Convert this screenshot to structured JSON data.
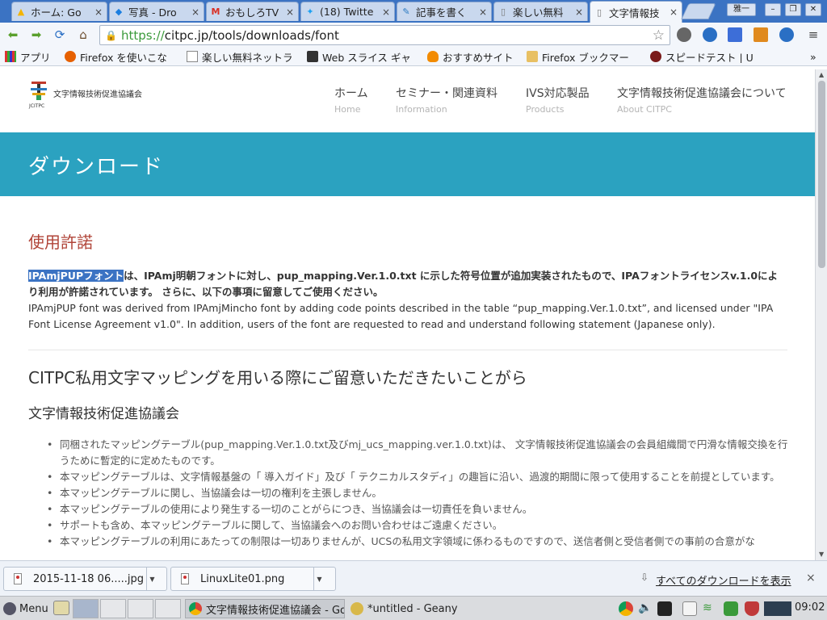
{
  "browser": {
    "tabs": [
      {
        "title": "ホーム: Go",
        "favicon": "google-drive-icon"
      },
      {
        "title": "写真 - Dro",
        "favicon": "dropbox-icon"
      },
      {
        "title": "おもしろTV",
        "favicon": "gmail-icon"
      },
      {
        "title": "(18) Twitte",
        "favicon": "twitter-icon"
      },
      {
        "title": "記事を書く",
        "favicon": "edit-icon"
      },
      {
        "title": "楽しい無料",
        "favicon": "page-icon"
      },
      {
        "title": "文字情報技",
        "favicon": "page-icon",
        "active": true
      }
    ],
    "tab_close": "×",
    "profile_label": "雅一",
    "window_controls": {
      "minimize": "–",
      "maximize": "❐",
      "close": "✕"
    },
    "url": {
      "scheme": "https://",
      "rest": "citpc.jp/tools/downloads/font"
    },
    "bookmarks": [
      {
        "label": "アプリ",
        "icon": "apps-icon"
      },
      {
        "label": "Firefox を使いこな",
        "icon": "firefox-icon"
      },
      {
        "label": "楽しい無料ネットラ",
        "icon": "page-icon"
      },
      {
        "label": "Web スライス ギャ",
        "icon": "webslice-icon"
      },
      {
        "label": "おすすめサイト",
        "icon": "bulb-icon"
      },
      {
        "label": "Firefox ブックマー",
        "icon": "folder-icon"
      },
      {
        "label": "スピードテスト | U",
        "icon": "speedtest-icon"
      }
    ],
    "bookmarks_overflow": "»"
  },
  "site": {
    "logo_text": "文字情報技術促進協議会",
    "logo_sub": "JCITPC",
    "nav": [
      {
        "ja": "ホーム",
        "en": "Home"
      },
      {
        "ja": "セミナー・関連資料",
        "en": "Information"
      },
      {
        "ja": "IVS対応製品",
        "en": "Products"
      },
      {
        "ja": "文字情報技術促進協議会について",
        "en": "About CITPC"
      }
    ],
    "banner_title": "ダウンロード",
    "section_heading": "使用許諾",
    "license_ja_highlight": "IPAmjPUPフォント",
    "license_ja_rest": "は、IPAmj明朝フォントに対し、pup_mapping.Ver.1.0.txt に示した符号位置が追加実装されたもので、IPAフォントライセンスv.1.0により利用が許諾されています。 さらに、以下の事項に留意してご使用ください。",
    "license_en": "IPAmjPUP font was derived from IPAmjMincho font by adding code points described in the table “pup_mapping.Ver.1.0.txt”, and licensed under \"IPA Font License Agreement v1.0\". In addition, users of the font are requested to read and understand following statement (Japanese only).",
    "notice_heading": "CITPC私用文字マッピングを用いる際にご留意いただきたいことがら",
    "notice_sub": "文字情報技術促進協議会",
    "notice_items": [
      "同梱されたマッピングテーブル(pup_mapping.Ver.1.0.txt及びmj_ucs_mapping.ver.1.0.txt)は、 文字情報技術促進協議会の会員組織間で円滑な情報交換を行うために暫定的に定めたものです。",
      "本マッピングテーブルは、文字情報基盤の「 導入ガイド」及び「 テクニカルスタディ」の趣旨に沿い、過渡的期間に限って使用することを前提としています。",
      "本マッピングテーブルに関し、当協議会は一切の権利を主張しません。",
      "本マッピングテーブルの使用により発生する一切のことがらにつき、当協議会は一切責任を負いません。",
      "サポートも含め、本マッピングテーブルに関して、当協議会へのお問い合わせはご遠慮ください。",
      "本マッピングテーブルの利用にあたっての制限は一切ありませんが、UCSの私用文字領域に係わるものですので、送信者側と受信者側での事前の合意がな"
    ]
  },
  "downloads": {
    "items": [
      "2015-11-18 06.....jpg",
      "LinuxLite01.png"
    ],
    "show_all": "すべてのダウンロードを表示",
    "close": "×"
  },
  "taskbar": {
    "menu_label": "Menu",
    "tasks": [
      {
        "label": "文字情報技術促進協議会 - Goo",
        "icon": "chrome-icon"
      },
      {
        "label": "*untitled - Geany",
        "icon": "geany-icon"
      }
    ],
    "clock": "09:02"
  }
}
